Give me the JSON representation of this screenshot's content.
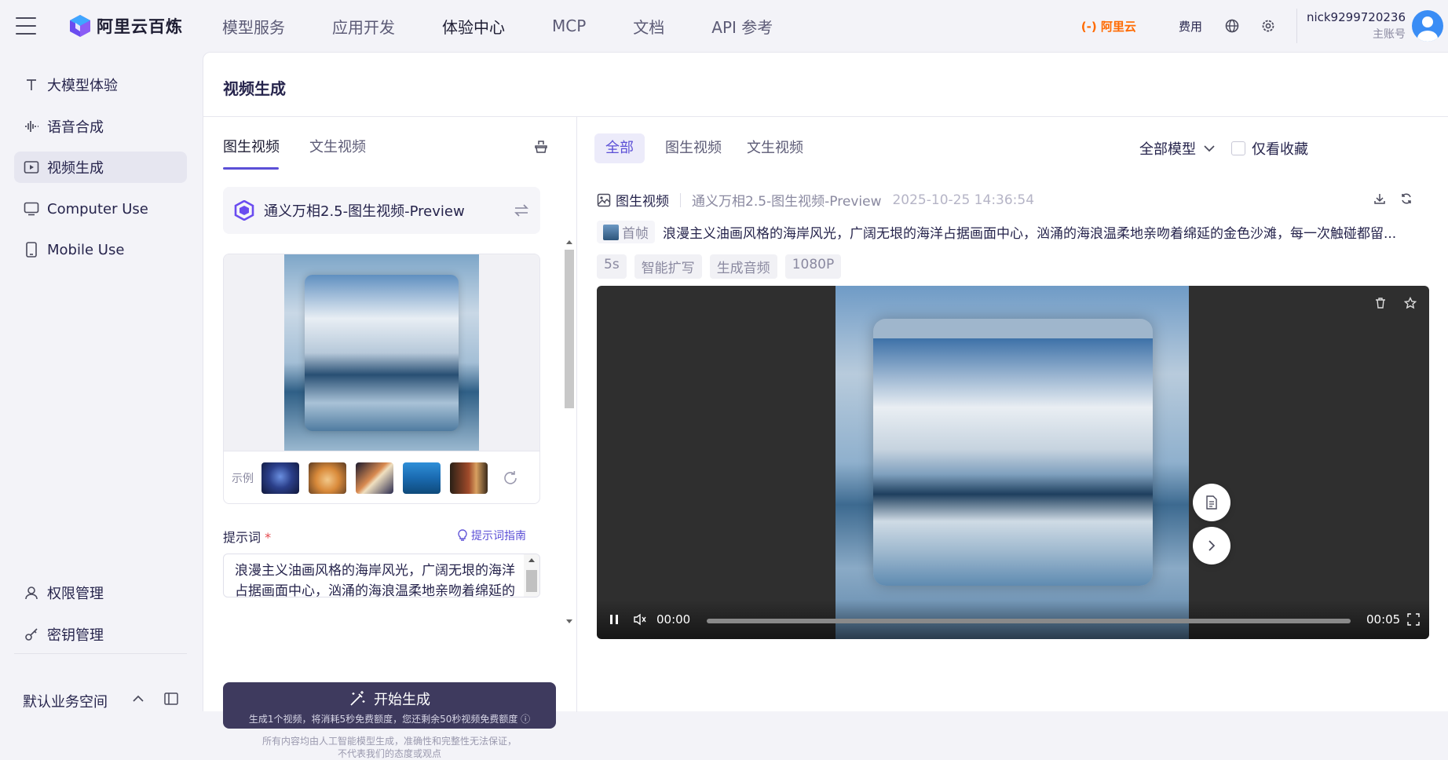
{
  "app": {
    "logo_text": "阿里云百炼"
  },
  "topnav": {
    "items": [
      "模型服务",
      "应用开发",
      "体验中心",
      "MCP",
      "文档",
      "API 参考"
    ],
    "active": "体验中心"
  },
  "topright": {
    "brand": "(-) 阿里云",
    "fee": "费用",
    "username": "nick9299720236",
    "role": "主账号"
  },
  "sidebar": {
    "items": [
      {
        "label": "大模型体验",
        "icon": "text-icon"
      },
      {
        "label": "语音合成",
        "icon": "audio-wave-icon"
      },
      {
        "label": "视频生成",
        "icon": "video-icon",
        "active": true
      },
      {
        "label": "Computer Use",
        "icon": "monitor-icon"
      },
      {
        "label": "Mobile Use",
        "icon": "mobile-icon"
      }
    ],
    "bottom": [
      {
        "label": "权限管理",
        "icon": "user-icon"
      },
      {
        "label": "密钥管理",
        "icon": "key-icon"
      }
    ],
    "workspace": "默认业务空间"
  },
  "page": {
    "title": "视频生成"
  },
  "left": {
    "tabs": [
      "图生视频",
      "文生视频"
    ],
    "model_name": "通义万相2.5-图生视频-Preview",
    "examples_label": "示例",
    "prompt_label": "提示词",
    "prompt_required": "*",
    "prompt_guide": "提示词指南",
    "prompt_text": "浪漫主义油画风格的海岸风光，广阔无垠的海洋占据画面中心，汹涌的海浪温柔地亲吻着绵延的金色沙滩，每一次触碰都留",
    "generate_label": "开始生成",
    "generate_sub": "生成1个视频，将消耗5秒免费额度，您还剩余50秒视频免费额度 ⓘ",
    "disclaimer_1": "所有内容均由人工智能模型生成，准确性和完整性无法保证，",
    "disclaimer_2": "不代表我们的态度或观点"
  },
  "right": {
    "filter_tabs": [
      "全部",
      "图生视频",
      "文生视频"
    ],
    "all_models": "全部模型",
    "favorites_only": "仅看收藏",
    "item": {
      "type": "图生视频",
      "model": "通义万相2.5-图生视频-Preview",
      "timestamp": "2025-10-25 14:36:54",
      "frame_label": "首帧",
      "description": "浪漫主义油画风格的海岸风光，广阔无垠的海洋占据画面中心，汹涌的海浪温柔地亲吻着绵延的金色沙滩，每一次触碰都留...",
      "tags": [
        "5s",
        "智能扩写",
        "生成音频",
        "1080P"
      ],
      "time_current": "00:00",
      "time_total": "00:05",
      "progress": 0.0
    }
  },
  "colors": {
    "accent": "#5b4fd6",
    "brand_orange": "#ff6a00",
    "button_dark": "#3e3a5e"
  }
}
